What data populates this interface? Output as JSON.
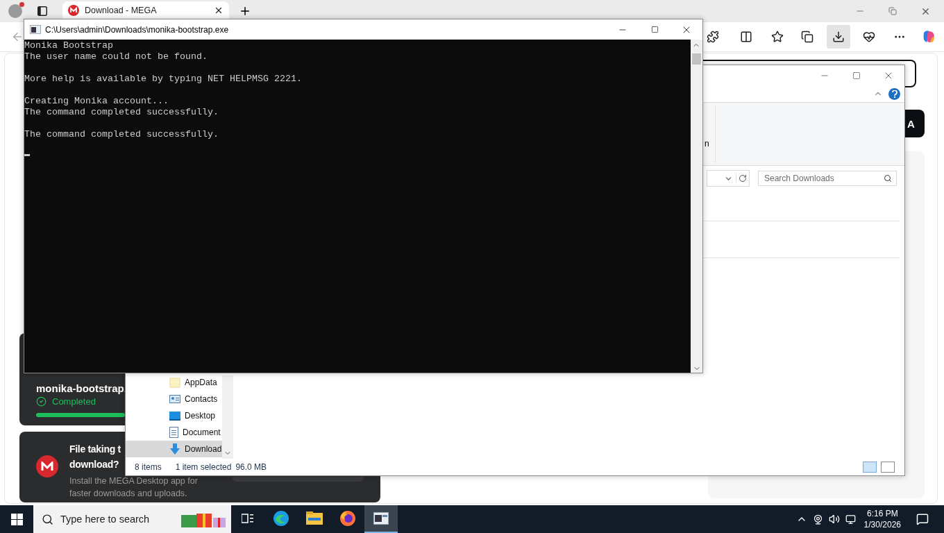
{
  "browser": {
    "tab": {
      "title": "Download - MEGA",
      "selected": true
    },
    "page": {
      "download_card": {
        "file_name": "monika-bootstrap.",
        "status": "Completed",
        "level": 1
      },
      "promo": {
        "title_lines": [
          "File taking t",
          "download?"
        ],
        "text_lines": [
          "Install the MEGA Desktop app for",
          "faster downloads and uploads."
        ]
      },
      "button_fragment": "A"
    }
  },
  "console": {
    "title": "C:\\Users\\admin\\Downloads\\monika-bootstrap.exe",
    "blocks": [
      [
        "Monika Bootstrap",
        "The user name could not be found."
      ],
      [
        "More help is available by typing NET HELPMSG 2221."
      ],
      [
        "Creating Monika account...",
        "The command completed successfully."
      ],
      [
        "The command completed successfully."
      ]
    ]
  },
  "explorer": {
    "ribbon_fragment": "n",
    "search": {
      "placeholder": "Search Downloads"
    },
    "nav_items": [
      {
        "label": "AppData",
        "kind": "folder",
        "selected": false
      },
      {
        "label": "Contacts",
        "kind": "contacts",
        "selected": false
      },
      {
        "label": "Desktop",
        "kind": "desktop",
        "selected": false
      },
      {
        "label": "Document",
        "kind": "documents",
        "selected": false
      },
      {
        "label": "Download",
        "kind": "downloads",
        "selected": true
      }
    ],
    "status": {
      "items": "8 items",
      "selection": "1 item selected",
      "size": "96.0 MB"
    }
  },
  "taskbar": {
    "search": {
      "placeholder": "Type here to search"
    },
    "apps": [
      {
        "kind": "edge",
        "selected": false
      },
      {
        "kind": "explorer",
        "selected": false
      },
      {
        "kind": "firefox",
        "selected": false
      },
      {
        "kind": "console",
        "selected": true
      }
    ],
    "time": "6:16 PM",
    "date": "1/30/2026"
  }
}
